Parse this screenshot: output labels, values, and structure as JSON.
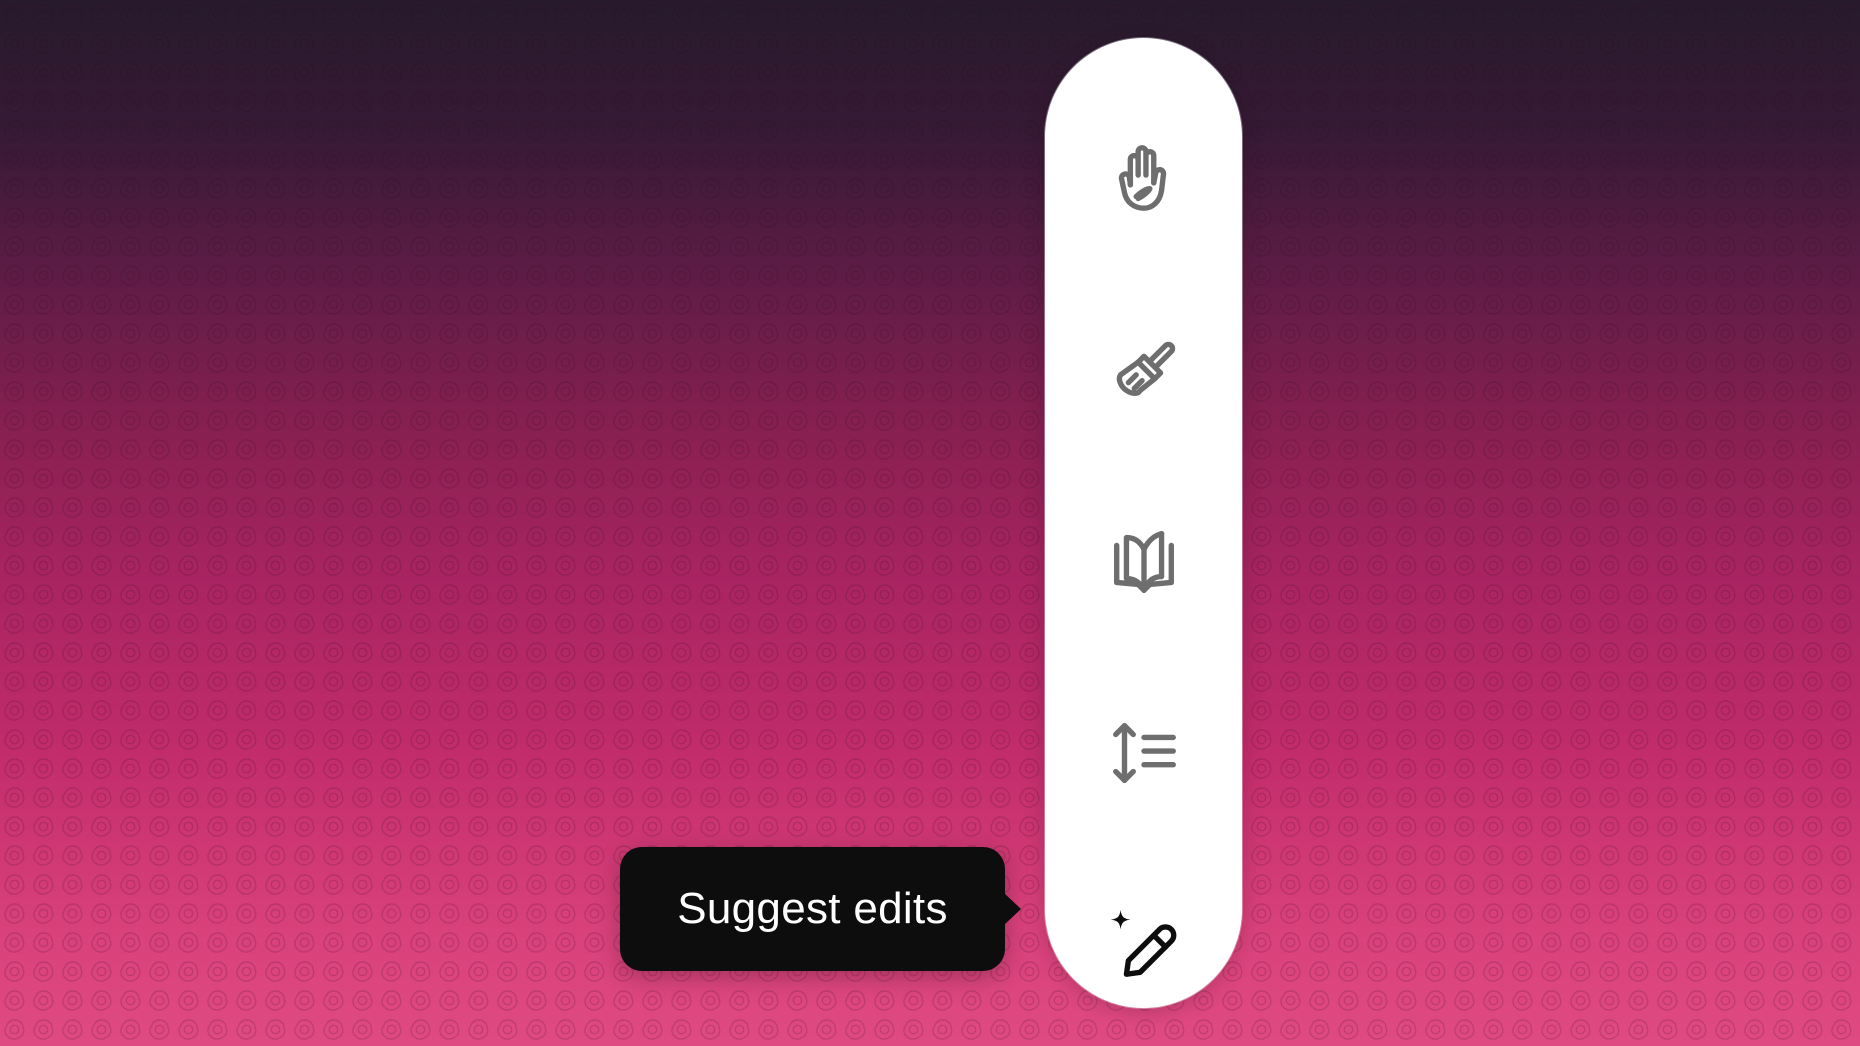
{
  "colors": {
    "background_top": "#271a2c",
    "background_middle": "#a82461",
    "background_bottom": "#e04a82",
    "toolbar_background": "#ffffff",
    "icon_inactive": "#6e6e6e",
    "icon_active": "#0d0d0d",
    "tooltip_background": "#0d0d0d",
    "tooltip_text": "#ffffff"
  },
  "toolbar": {
    "items": [
      {
        "id": "add-emojis",
        "icon": "hand-icon",
        "active": false
      },
      {
        "id": "add-final-polish",
        "icon": "paintbrush-icon",
        "active": false
      },
      {
        "id": "reading-level",
        "icon": "open-book-icon",
        "active": false
      },
      {
        "id": "adjust-length",
        "icon": "length-adjust-icon",
        "active": false
      },
      {
        "id": "suggest-edits",
        "icon": "sparkle-pencil-icon",
        "active": true
      }
    ]
  },
  "tooltip": {
    "text": "Suggest edits"
  }
}
